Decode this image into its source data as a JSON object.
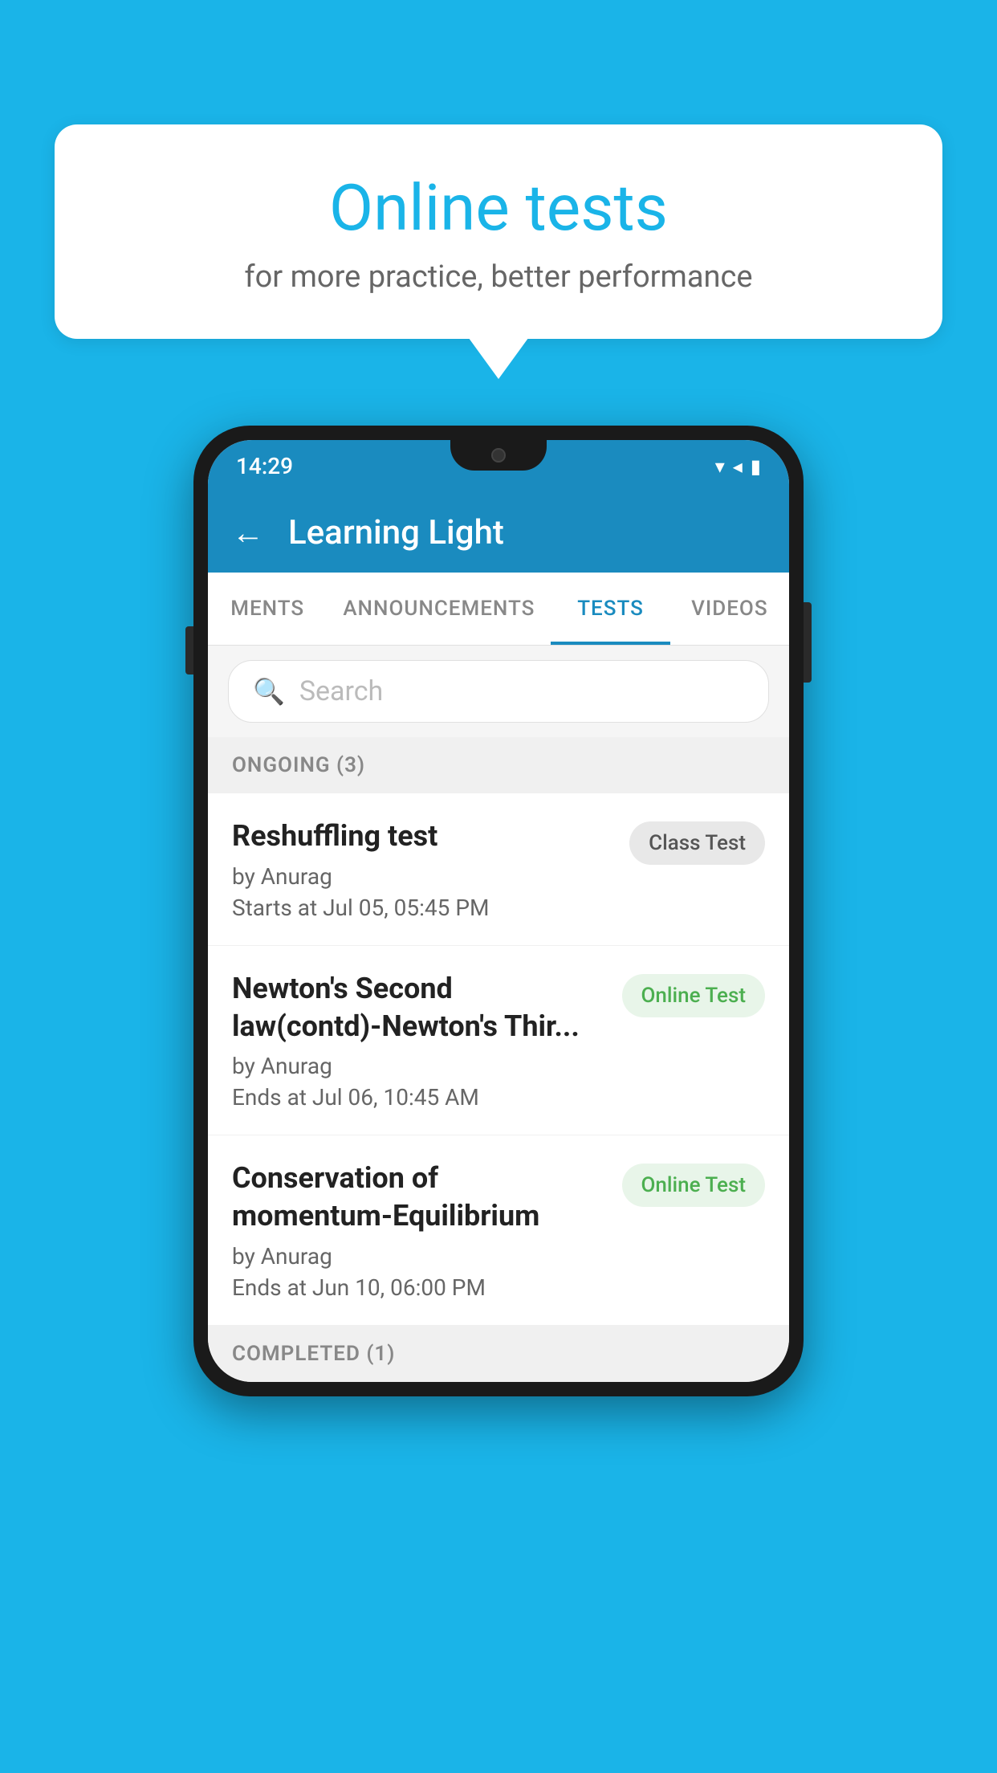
{
  "background_color": "#1ab4e8",
  "bubble": {
    "title": "Online tests",
    "subtitle": "for more practice, better performance"
  },
  "phone": {
    "status_bar": {
      "time": "14:29",
      "icons": "▾◂▮"
    },
    "app_bar": {
      "title": "Learning Light",
      "back_label": "←"
    },
    "tabs": [
      {
        "label": "MENTS",
        "active": false
      },
      {
        "label": "ANNOUNCEMENTS",
        "active": false
      },
      {
        "label": "TESTS",
        "active": true
      },
      {
        "label": "VIDEOS",
        "active": false
      }
    ],
    "search": {
      "placeholder": "Search"
    },
    "sections": [
      {
        "header": "ONGOING (3)",
        "items": [
          {
            "name": "Reshuffling test",
            "author": "by Anurag",
            "date": "Starts at  Jul 05, 05:45 PM",
            "badge": "Class Test",
            "badge_type": "class"
          },
          {
            "name": "Newton's Second law(contd)-Newton's Thir...",
            "author": "by Anurag",
            "date": "Ends at  Jul 06, 10:45 AM",
            "badge": "Online Test",
            "badge_type": "online"
          },
          {
            "name": "Conservation of momentum-Equilibrium",
            "author": "by Anurag",
            "date": "Ends at  Jun 10, 06:00 PM",
            "badge": "Online Test",
            "badge_type": "online"
          }
        ]
      },
      {
        "header": "COMPLETED (1)",
        "items": []
      }
    ]
  }
}
